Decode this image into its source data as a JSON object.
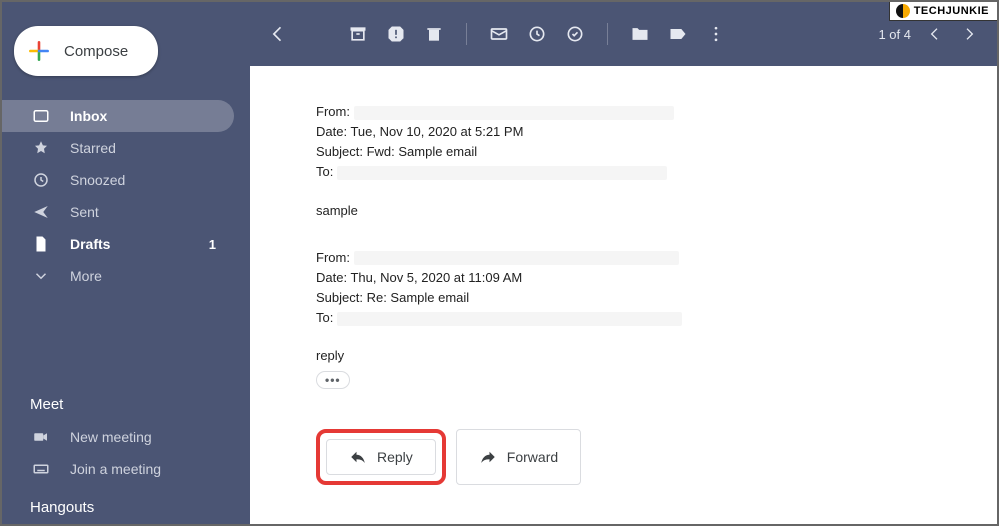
{
  "watermark": {
    "text": "TECHJUNKIE"
  },
  "sidebar": {
    "compose_label": "Compose",
    "items": [
      {
        "label": "Inbox",
        "icon": "inbox"
      },
      {
        "label": "Starred",
        "icon": "star"
      },
      {
        "label": "Snoozed",
        "icon": "clock"
      },
      {
        "label": "Sent",
        "icon": "send"
      },
      {
        "label": "Drafts",
        "icon": "file",
        "count": "1"
      },
      {
        "label": "More",
        "icon": "chevron-down"
      }
    ],
    "meet": {
      "heading": "Meet",
      "items": [
        {
          "label": "New meeting",
          "icon": "video"
        },
        {
          "label": "Join a meeting",
          "icon": "keyboard"
        }
      ]
    },
    "hangouts": {
      "heading": "Hangouts"
    }
  },
  "toolbar": {
    "pager_text": "1 of 4"
  },
  "email": {
    "quoted1": {
      "from_label": "From:",
      "date": "Date: Tue, Nov 10, 2020 at 5:21 PM",
      "subject": "Subject: Fwd: Sample email",
      "to_label": "To:"
    },
    "body1": "sample",
    "quoted2": {
      "from_label": "From:",
      "date": "Date: Thu, Nov 5, 2020 at 11:09 AM",
      "subject": "Subject: Re: Sample email",
      "to_label": "To:"
    },
    "body2": "reply",
    "trimmed": "•••",
    "actions": {
      "reply": "Reply",
      "forward": "Forward"
    }
  }
}
